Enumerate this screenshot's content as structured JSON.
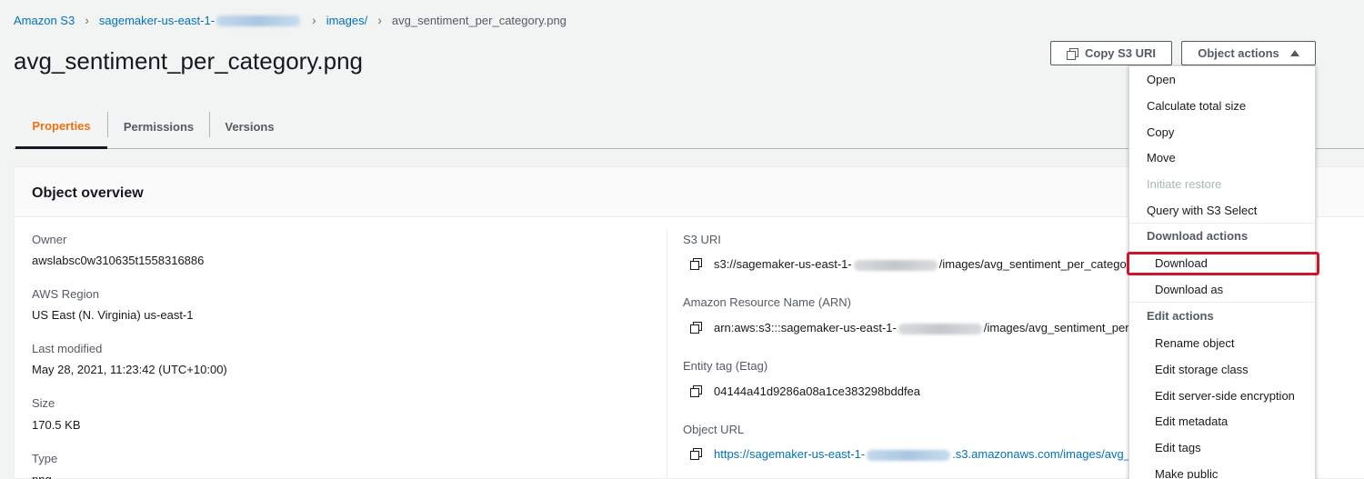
{
  "breadcrumb": {
    "root": "Amazon S3",
    "bucket_prefix": "sagemaker-us-east-1-",
    "folder": "images/",
    "current": "avg_sentiment_per_category.png"
  },
  "page_title": "avg_sentiment_per_category.png",
  "header_buttons": {
    "copy_uri": "Copy S3 URI",
    "object_actions": "Object actions"
  },
  "tabs": [
    {
      "label": "Properties",
      "active": true
    },
    {
      "label": "Permissions",
      "active": false
    },
    {
      "label": "Versions",
      "active": false
    }
  ],
  "overview": {
    "title": "Object overview",
    "left": [
      {
        "label": "Owner",
        "value": "awslabsc0w310635t1558316886"
      },
      {
        "label": "AWS Region",
        "value": "US East (N. Virginia) us-east-1"
      },
      {
        "label": "Last modified",
        "value": "May 28, 2021, 11:23:42 (UTC+10:00)"
      },
      {
        "label": "Size",
        "value": "170.5 KB"
      },
      {
        "label": "Type",
        "value": "png"
      }
    ],
    "right": {
      "s3_uri": {
        "label": "S3 URI",
        "prefix": "s3://sagemaker-us-east-1-",
        "suffix": "/images/avg_sentiment_per_catego"
      },
      "arn": {
        "label": "Amazon Resource Name (ARN)",
        "prefix": "arn:aws:s3:::sagemaker-us-east-1-",
        "suffix": "/images/avg_sentiment_per_"
      },
      "etag": {
        "label": "Entity tag (Etag)",
        "value": "04144a41d9286a08a1ce383298bddfea"
      },
      "url": {
        "label": "Object URL",
        "prefix": "https://sagemaker-us-east-1-",
        "suffix": ".s3.amazonaws.com/images/avg_"
      }
    }
  },
  "menu": {
    "open": "Open",
    "calc_size": "Calculate total size",
    "copy": "Copy",
    "move": "Move",
    "initiate_restore": "Initiate restore",
    "query_select": "Query with S3 Select",
    "download_actions": "Download actions",
    "download": "Download",
    "download_as": "Download as",
    "edit_actions": "Edit actions",
    "rename": "Rename object",
    "edit_storage": "Edit storage class",
    "edit_encryption": "Edit server-side encryption",
    "edit_metadata": "Edit metadata",
    "edit_tags": "Edit tags",
    "make_public": "Make public"
  },
  "colors": {
    "link": "#0073bb",
    "active_tab": "#ec7211",
    "highlight": "#d0142a"
  }
}
